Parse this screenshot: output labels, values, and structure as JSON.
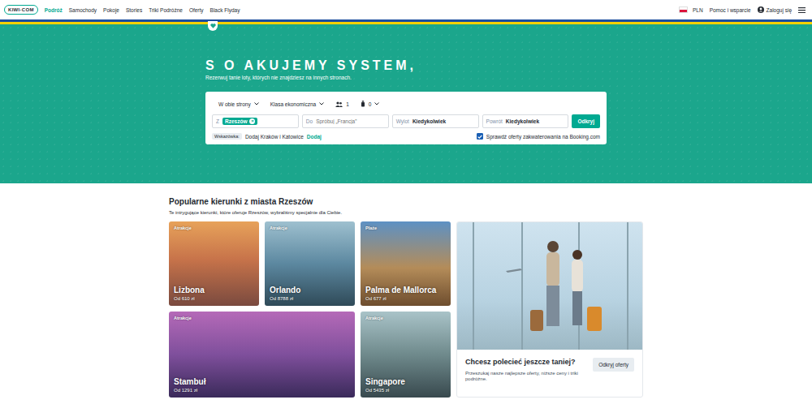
{
  "nav": {
    "logo": "KIWI·COM",
    "items": [
      {
        "label": "Podróż",
        "selected": true
      },
      {
        "label": "Samochody",
        "selected": false
      },
      {
        "label": "Pokoje",
        "selected": false
      },
      {
        "label": "Stories",
        "selected": false
      },
      {
        "label": "Triki Podróżne",
        "selected": false
      },
      {
        "label": "Oferty",
        "selected": false
      },
      {
        "label": "Black Flyday",
        "selected": false
      }
    ],
    "currency": "PLN",
    "help": "Pomoc i wsparcie",
    "login": "Zaloguj się"
  },
  "hero": {
    "title": "S O AKUJEMY SYSTEM,",
    "subtitle": "Rezerwuj tanie loty, których nie znajdziesz na innych stronach."
  },
  "search": {
    "trip_type": "W obie strony",
    "cabin": "Klasa ekonomiczna",
    "passengers": "1",
    "bags": "0",
    "from_label": "Z",
    "from_chip": "Rzeszów",
    "chip_remove": "×",
    "to_label": "Do",
    "to_placeholder": "Spróbuj „Francja”",
    "departure_label": "Wylot",
    "departure": "Kiedykolwiek",
    "return_label": "Powrót",
    "return": "Kiedykolwiek",
    "button": "Odkryj",
    "hint_badge": "Wskazówka:",
    "hint_text": "Dodaj Kraków i Katowice",
    "hint_action": "Dodaj",
    "booking_label": "Sprawdź oferty zakwaterowania na Booking.com",
    "booking_checked": true
  },
  "destinations": {
    "title": "Popularne kierunki z miasta Rzeszów",
    "subtitle": "Te intrygujące kierunki, które oferuje Rzeszów, wybraliśmy specjalnie dla Ciebie.",
    "cards": [
      {
        "tag": "Atrakcje",
        "city": "Lizbona",
        "price": "Od 610 zł"
      },
      {
        "tag": "Atrakcje",
        "city": "Orlando",
        "price": "Od 8788 zł"
      },
      {
        "tag": "Plaże",
        "city": "Palma de Mallorca",
        "price": "Od 677 zł"
      },
      {
        "tag": "Atrakcje",
        "city": "Stambuł",
        "price": "Od 1291 zł"
      },
      {
        "tag": "Atrakcje",
        "city": "Singapore",
        "price": "Od 5435 zł"
      }
    ]
  },
  "promo": {
    "title": "Chcesz polecieć jeszcze taniej?",
    "text": "Przeszukaj nasze najlepsze oferty, niższe ceny i triki podróżne.",
    "button": "Odkryj oferty"
  }
}
